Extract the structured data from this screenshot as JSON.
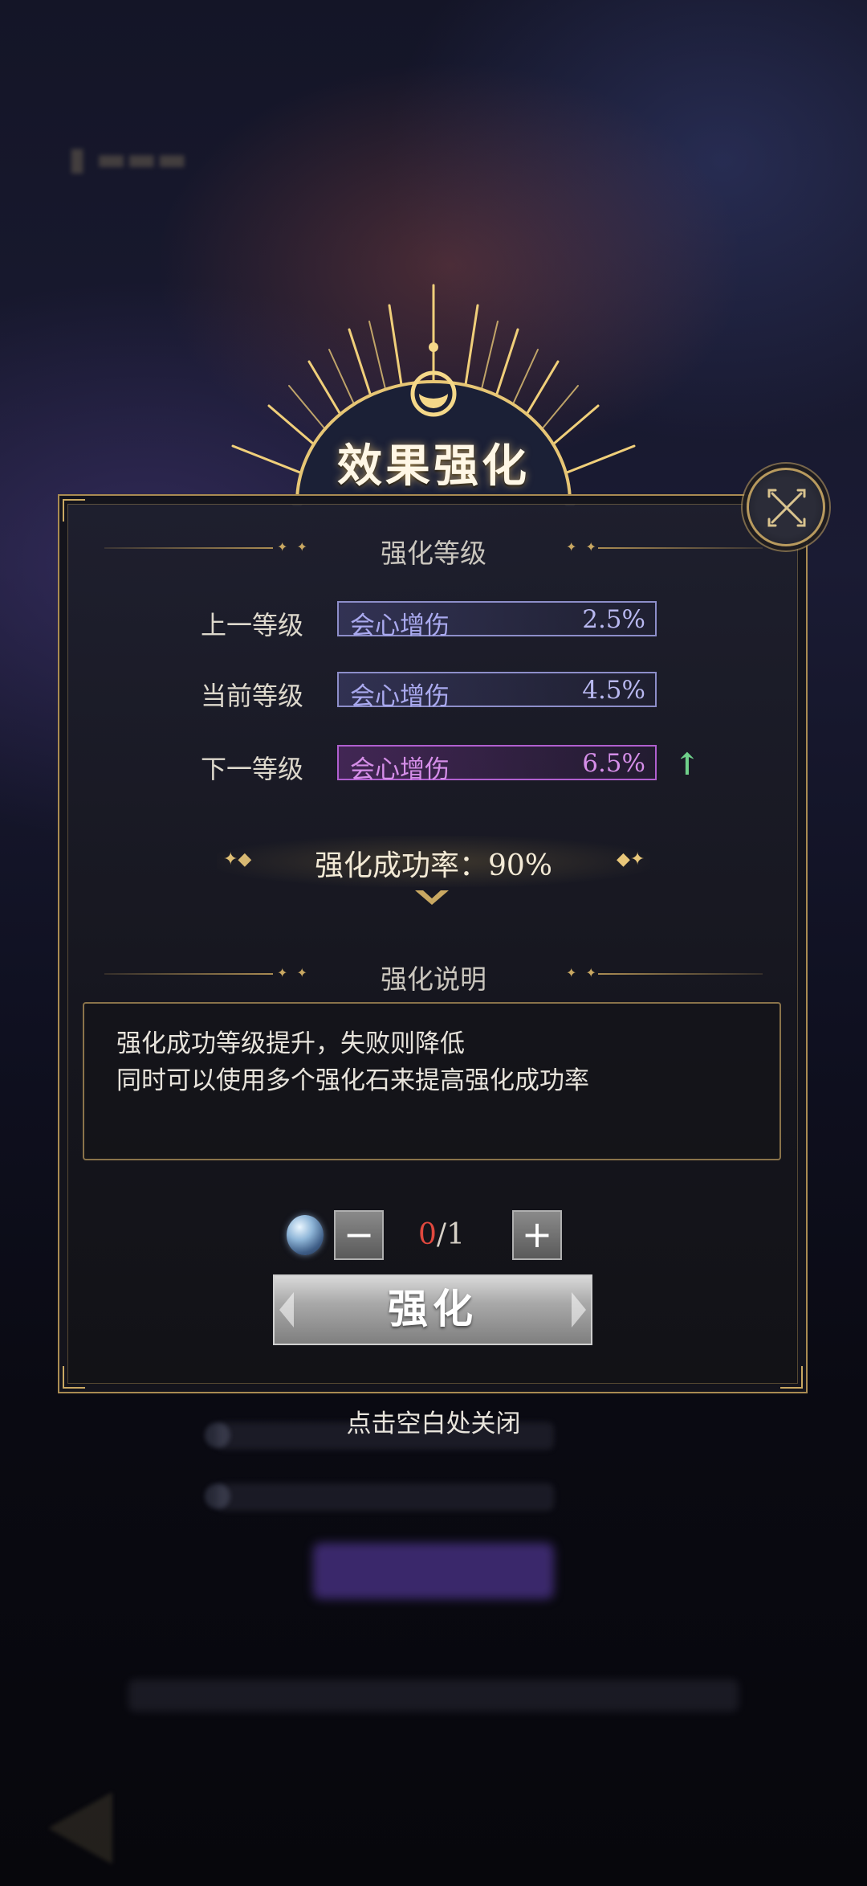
{
  "crest": {
    "title": "效果强化"
  },
  "levels": {
    "section_title": "强化等级",
    "rows": [
      {
        "label": "上一等级",
        "effect": "会心增伤",
        "value": "2.5%"
      },
      {
        "label": "当前等级",
        "effect": "会心增伤",
        "value": "4.5%"
      },
      {
        "label": "下一等级",
        "effect": "会心增伤",
        "value": "6.5%"
      }
    ],
    "success_rate": "强化成功率：90%"
  },
  "description": {
    "section_title": "强化说明",
    "lines": [
      "强化成功等级提升，失败则降低",
      "同时可以使用多个强化石来提高强化成功率"
    ]
  },
  "material": {
    "icon": "enhance-stone-icon",
    "current": "0",
    "separator": "/",
    "total": "1",
    "minus_label": "−",
    "plus_label": "+"
  },
  "actions": {
    "enhance_label": "强化"
  },
  "footer": {
    "close_hint": "点击空白处关闭"
  },
  "colors": {
    "gold": "#a98b52",
    "prev_current_border": "#8d8ec9",
    "next_border": "#b05fcf",
    "up_arrow": "#6fd08a",
    "count_current": "#e0483e"
  }
}
